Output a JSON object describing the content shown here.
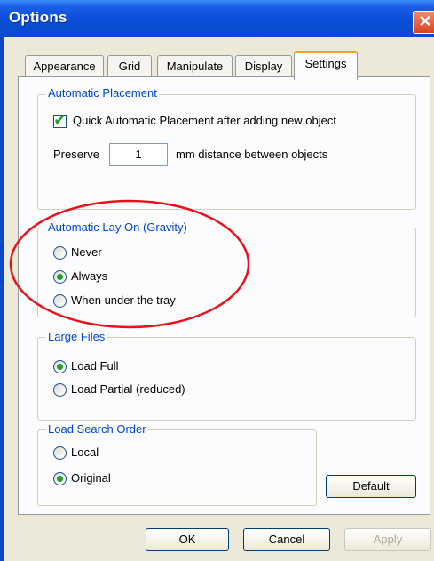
{
  "window": {
    "title": "Options",
    "close_icon": "close-icon"
  },
  "tabs": [
    {
      "label": "Appearance"
    },
    {
      "label": "Grid"
    },
    {
      "label": "Manipulate"
    },
    {
      "label": "Display"
    },
    {
      "label": "Settings",
      "active": true
    }
  ],
  "automatic_placement": {
    "legend": "Automatic Placement",
    "checkbox_label": "Quick Automatic Placement after adding new object",
    "checked": true,
    "preserve_label": "Preserve",
    "preserve_value": "1",
    "unit_label": "mm   distance between objects"
  },
  "gravity": {
    "legend": "Automatic Lay On (Gravity)",
    "options": [
      {
        "label": "Never",
        "selected": false
      },
      {
        "label": "Always",
        "selected": true
      },
      {
        "label": "When under the tray",
        "selected": false
      }
    ]
  },
  "large_files": {
    "legend": "Large Files",
    "options": [
      {
        "label": "Load Full",
        "selected": true
      },
      {
        "label": "Load Partial (reduced)",
        "selected": false
      }
    ]
  },
  "search_order": {
    "legend": "Load Search Order",
    "options": [
      {
        "label": "Local",
        "selected": false
      },
      {
        "label": "Original",
        "selected": true
      }
    ]
  },
  "buttons": {
    "default": "Default",
    "ok": "OK",
    "cancel": "Cancel",
    "apply": "Apply"
  },
  "colors": {
    "titlebar": "#0a4fd8",
    "legend": "#0046d5",
    "annotation": "#e8121b",
    "radio_dot": "#21a121"
  }
}
